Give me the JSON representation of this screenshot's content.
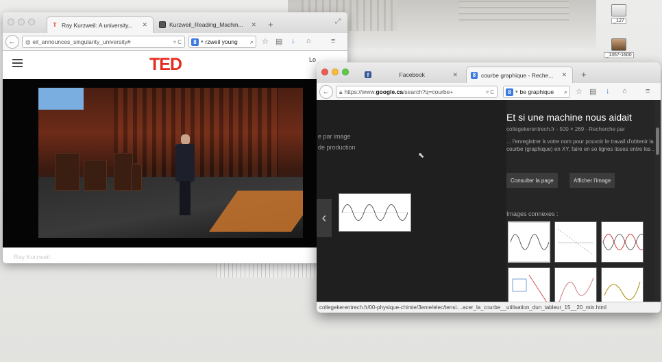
{
  "desktop": {
    "icons": [
      {
        "label": "_127"
      },
      {
        "label": "_1357-1600"
      }
    ]
  },
  "win1": {
    "tabs": [
      {
        "title": "Ray Kurzweil: A university...",
        "icon": "ted-favicon"
      },
      {
        "title": "Kurzweil_Reading_Machin...",
        "icon": "image-favicon"
      }
    ],
    "url": "eil_announces_singularity_university#",
    "search": "rzweil young",
    "brand": "TED",
    "login": "Lo",
    "below_video": "Ray Kurzweil:"
  },
  "win2": {
    "tabs": [
      {
        "title": "Facebook",
        "icon": "facebook-favicon"
      },
      {
        "title": "courbe graphique - Reche...",
        "icon": "google-favicon"
      }
    ],
    "url_prefix": "https://www.",
    "url_domain": "google.ca",
    "url_rest": "/search?q=courbe+",
    "search": "be graphique",
    "sidebar_links": [
      "e par image",
      "de production"
    ],
    "panel": {
      "title": "Et si une machine nous aidait",
      "source": "collegekerentrech.fr - 500 × 269 - Recherche par",
      "description": "... l'enregistrer à votre nom pour pouvoir le travail d'obtenir la courbe (graphique) en XY, faire en so lignes lisses entre les ...",
      "button_visit": "Consulter la page",
      "button_view": "Afficher l'image",
      "related_heading": "Images connexes :"
    },
    "status_url": "collegekerentrech.fr/00-physique-chimie/3eme/elec/tensi....acer_la_courbe__utilisation_dun_tableur_15__20_min.html"
  },
  "colors": {
    "ted_red": "#e62b1e",
    "google_dark": "#222222",
    "link_blue": "#2f7bd8"
  }
}
